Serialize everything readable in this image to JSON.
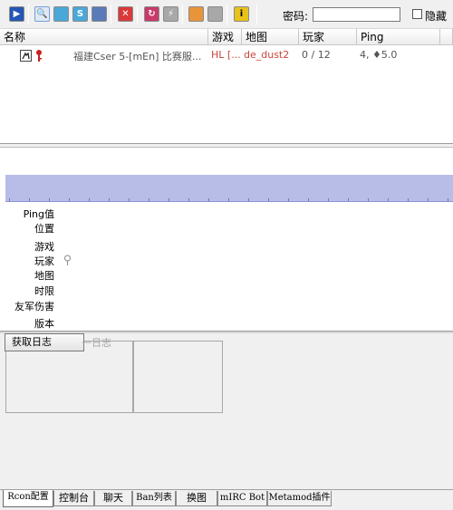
{
  "toolbar": {
    "password_label": "密码:",
    "password_value": "",
    "hide_label": "隐藏"
  },
  "columns": [
    "名称",
    "游戏",
    "地图",
    "玩家",
    "Ping"
  ],
  "server": {
    "name": "福建Cser  5-[mEn] 比赛服...",
    "game": "HL [...",
    "map": "de_dust2",
    "players": "0 / 12",
    "ping": "4, ♦5.0"
  },
  "info_labels": [
    "Ping值",
    "位置",
    "游戏",
    "玩家",
    "地图",
    "时限",
    "友军伤害",
    "版本"
  ],
  "log": {
    "fetch_button": "获取日志",
    "ghost_text": "一日志"
  },
  "tabs": [
    "Rcon配置",
    "控制台",
    "聊天",
    "Ban列表",
    "换图",
    "mIRC Bot",
    "Metamod插件"
  ],
  "colors": {
    "graph_fill": "#b8bde8",
    "server_game": "#c8463a",
    "server_map": "#c8463a"
  }
}
